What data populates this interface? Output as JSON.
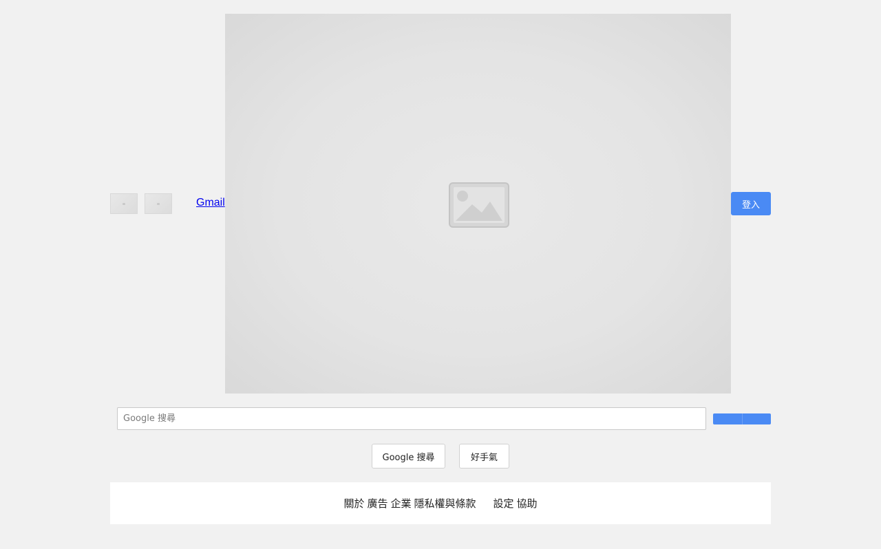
{
  "header": {
    "thumbnails": [
      {
        "icon": "broken-image-icon"
      },
      {
        "icon": "broken-image-icon"
      }
    ],
    "gmail_link": "Gmail",
    "signin_button": "登入"
  },
  "hero": {
    "icon": "image-placeholder-icon"
  },
  "search": {
    "placeholder": "Google 搜尋",
    "value": ""
  },
  "actions": {
    "search_button": "Google 搜尋",
    "lucky_button": "好手氣"
  },
  "footer": {
    "left_links": [
      "關於",
      "廣告",
      "企業",
      "隱私權與條款"
    ],
    "right_links": [
      "設定",
      "協助"
    ]
  },
  "colors": {
    "accent": "#4a8af4",
    "background": "#f1f1f1",
    "link": "#0000ee"
  }
}
